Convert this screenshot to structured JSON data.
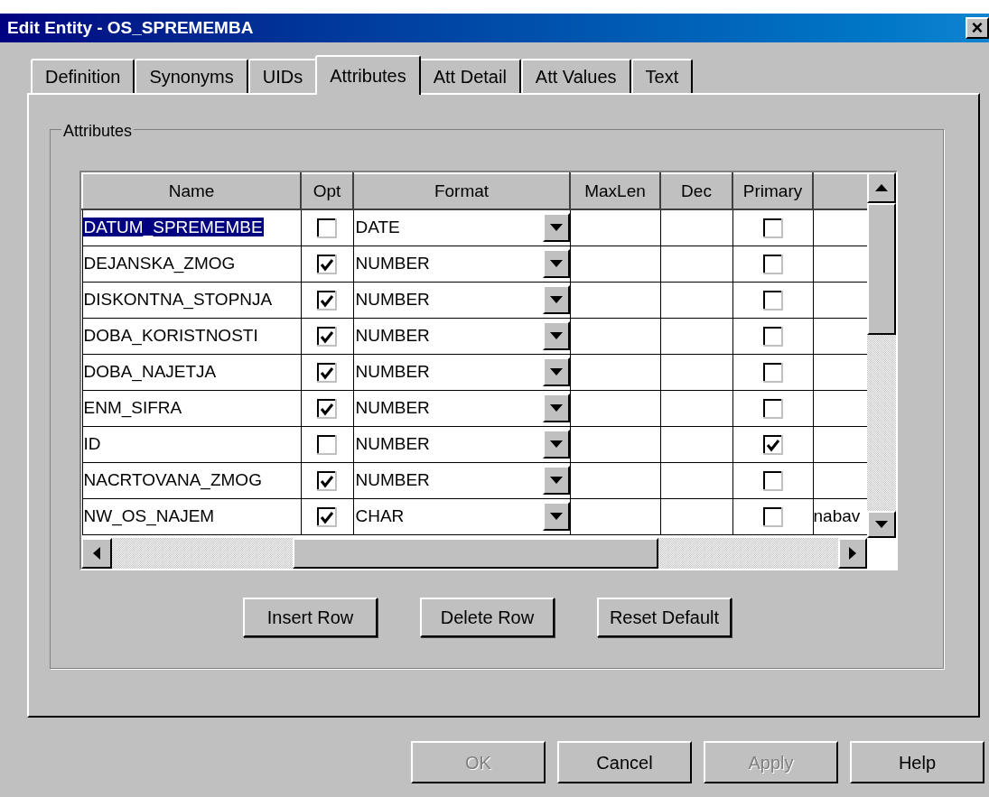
{
  "window": {
    "title": "Edit Entity - OS_SPREMEMBA",
    "close": "×"
  },
  "tabs": [
    {
      "label": "Definition",
      "selected": false
    },
    {
      "label": "Synonyms",
      "selected": false
    },
    {
      "label": "UIDs",
      "selected": false
    },
    {
      "label": "Attributes",
      "selected": true
    },
    {
      "label": "Att Detail",
      "selected": false
    },
    {
      "label": "Att Values",
      "selected": false
    },
    {
      "label": "Text",
      "selected": false
    }
  ],
  "group": {
    "title": "Attributes"
  },
  "table": {
    "columns": [
      "Name",
      "Opt",
      "Format",
      "MaxLen",
      "Dec",
      "Primary"
    ],
    "rows": [
      {
        "name": "DATUM_SPREMEMBE",
        "opt": false,
        "format": "DATE",
        "primary": false,
        "selected": true
      },
      {
        "name": "DEJANSKA_ZMOG",
        "opt": true,
        "format": "NUMBER",
        "primary": false,
        "selected": false
      },
      {
        "name": "DISKONTNA_STOPNJA",
        "opt": true,
        "format": "NUMBER",
        "primary": false,
        "selected": false
      },
      {
        "name": "DOBA_KORISTNOSTI",
        "opt": true,
        "format": "NUMBER",
        "primary": false,
        "selected": false
      },
      {
        "name": "DOBA_NAJETJA",
        "opt": true,
        "format": "NUMBER",
        "primary": false,
        "selected": false
      },
      {
        "name": "ENM_SIFRA",
        "opt": true,
        "format": "NUMBER",
        "primary": false,
        "selected": false
      },
      {
        "name": "ID",
        "opt": false,
        "format": "NUMBER",
        "primary": true,
        "selected": false
      },
      {
        "name": "NACRTOVANA_ZMOG",
        "opt": true,
        "format": "NUMBER",
        "primary": false,
        "selected": false
      },
      {
        "name": "NW_OS_NAJEM",
        "opt": true,
        "format": "CHAR",
        "primary": false,
        "selected": false,
        "column_7": "nabav"
      }
    ]
  },
  "table_buttons": [
    "Insert Row",
    "Delete Row",
    "Reset Default"
  ],
  "dialog_buttons": [
    {
      "label": "OK",
      "disabled": true
    },
    {
      "label": "Cancel",
      "disabled": false
    },
    {
      "label": "Apply",
      "disabled": true
    },
    {
      "label": "Help",
      "disabled": false
    }
  ]
}
